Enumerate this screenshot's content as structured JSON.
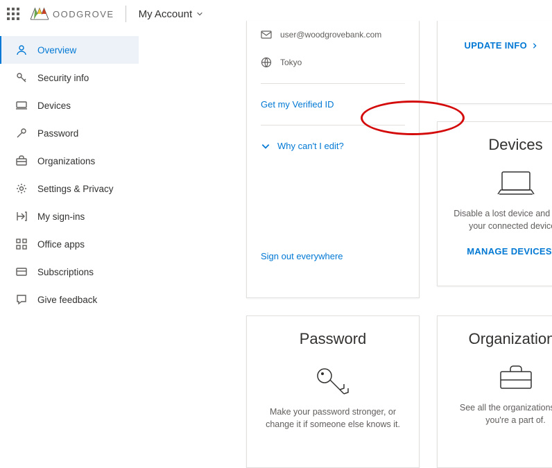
{
  "header": {
    "brand_name": "OODGROVE",
    "page_context": "My Account"
  },
  "sidebar": {
    "items": [
      {
        "label": "Overview",
        "name": "sidebar-item-overview",
        "icon": "person",
        "active": true
      },
      {
        "label": "Security info",
        "name": "sidebar-item-security",
        "icon": "key"
      },
      {
        "label": "Devices",
        "name": "sidebar-item-devices",
        "icon": "laptop"
      },
      {
        "label": "Password",
        "name": "sidebar-item-password",
        "icon": "keyrot"
      },
      {
        "label": "Organizations",
        "name": "sidebar-item-organizations",
        "icon": "briefcase"
      },
      {
        "label": "Settings & Privacy",
        "name": "sidebar-item-settings-privacy",
        "icon": "gear"
      },
      {
        "label": "My sign-ins",
        "name": "sidebar-item-my-signins",
        "icon": "signin"
      },
      {
        "label": "Office apps",
        "name": "sidebar-item-office-apps",
        "icon": "apps"
      },
      {
        "label": "Subscriptions",
        "name": "sidebar-item-subscriptions",
        "icon": "card"
      },
      {
        "label": "Give feedback",
        "name": "sidebar-item-give-feedback",
        "icon": "chat"
      }
    ]
  },
  "profile_card": {
    "email": "user@woodgrovebank.com",
    "location": "Tokyo",
    "verified_id_link": "Get my Verified ID",
    "why_cant_edit": "Why can't I edit?",
    "sign_out_link": "Sign out everywhere"
  },
  "updateinfo_card": {
    "action": "UPDATE INFO"
  },
  "devices_card": {
    "title": "Devices",
    "desc": "Disable a lost device and review your connected devices.",
    "action": "MANAGE DEVICES"
  },
  "password_card": {
    "title": "Password",
    "desc": "Make your password stronger, or change it if someone else knows it."
  },
  "org_card": {
    "title": "Organizations",
    "desc": "See all the organizations that you're a part of."
  }
}
